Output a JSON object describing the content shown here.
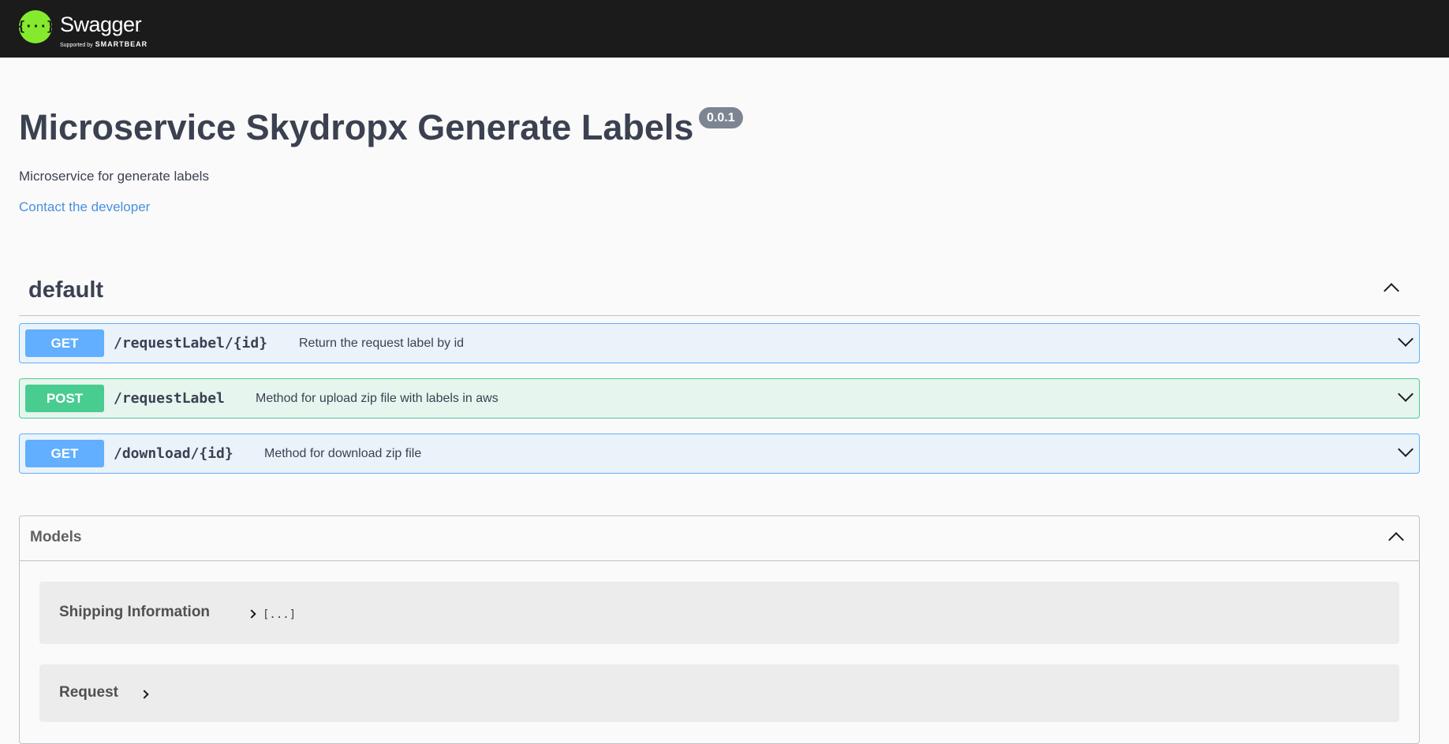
{
  "topbar": {
    "logo_glyph": "{···}",
    "brand": "Swagger",
    "brand_tm": ".",
    "supported_by": "Supported by",
    "smartbear": "SMARTBEAR"
  },
  "info": {
    "title": "Microservice Skydropx Generate Labels",
    "version": "0.0.1",
    "description": "Microservice for generate labels",
    "contact": "Contact the developer"
  },
  "tag": {
    "name": "default",
    "operations": [
      {
        "method": "GET",
        "path": "/requestLabel/{id}",
        "summary": "Return the request label by id"
      },
      {
        "method": "POST",
        "path": "/requestLabel",
        "summary": "Method for upload zip file with labels in aws"
      },
      {
        "method": "GET",
        "path": "/download/{id}",
        "summary": "Method for download zip file"
      }
    ]
  },
  "models": {
    "title": "Models",
    "items": [
      {
        "name": "Shipping Information",
        "brace": "[...]"
      },
      {
        "name": "Request",
        "brace": ""
      }
    ]
  },
  "colors": {
    "get": "#61affe",
    "post": "#49cc90",
    "topbar": "#1b1b1b",
    "logo": "#85ea2d",
    "link": "#4990e2"
  },
  "icons": {
    "collapse": "chevron-up-icon",
    "expand": "chevron-down-icon",
    "model_expand": "chevron-right-icon"
  }
}
